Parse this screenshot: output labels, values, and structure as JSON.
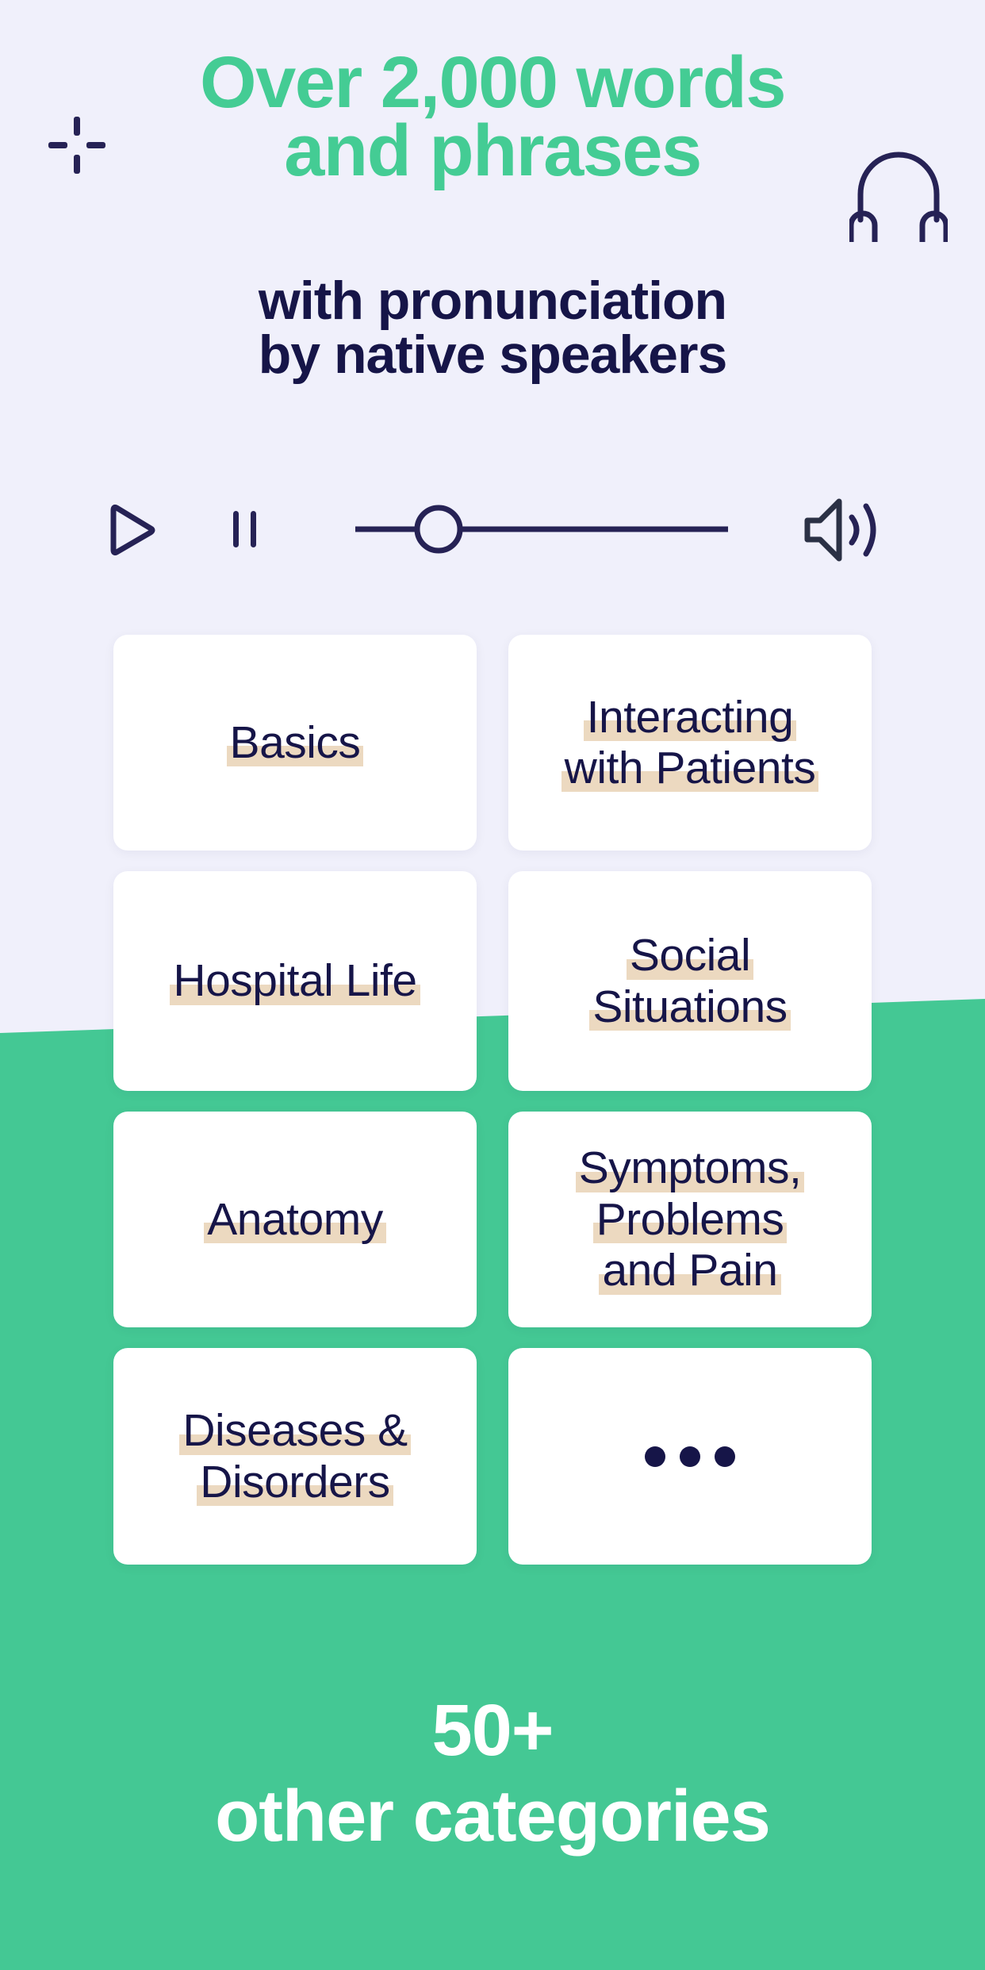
{
  "theme": {
    "background_top": "#f0f0fb",
    "background_bottom": "#44c894",
    "accent_green": "#44cc94",
    "ink_navy": "#161548",
    "highlight_beige": "#ecd9c0",
    "card_white": "#ffffff"
  },
  "hero": {
    "headline": "Over 2,000 words\nand phrases",
    "subheadline": "with pronunciation\nby native speakers",
    "sparkle_icon": "sparkle-plus-icon",
    "headphones_icon": "headphones-icon"
  },
  "player": {
    "play_label": "play-icon",
    "pause_label": "pause-icon",
    "slider_label": "progress-slider",
    "slider_value_percent": 22,
    "volume_label": "volume-speaker-icon"
  },
  "categories": {
    "rows": [
      [
        {
          "label": "Basics",
          "lines": [
            "Basics"
          ]
        },
        {
          "label": "Interacting with Patients",
          "lines": [
            "Interacting",
            "with Patients"
          ]
        }
      ],
      [
        {
          "label": "Hospital Life",
          "lines": [
            "Hospital Life"
          ]
        },
        {
          "label": "Social Situations",
          "lines": [
            "Social",
            "Situations"
          ]
        }
      ],
      [
        {
          "label": "Anatomy",
          "lines": [
            "Anatomy"
          ]
        },
        {
          "label": "Symptoms, Problems and Pain",
          "lines": [
            "Symptoms,",
            "Problems",
            "and Pain"
          ]
        }
      ],
      [
        {
          "label": "Diseases & Disorders",
          "lines": [
            "Diseases &",
            "Disorders"
          ]
        },
        {
          "label": "More categories",
          "lines": [],
          "icon": "ellipsis-icon"
        }
      ]
    ]
  },
  "footer": {
    "number": "50+",
    "caption": "other categories"
  }
}
